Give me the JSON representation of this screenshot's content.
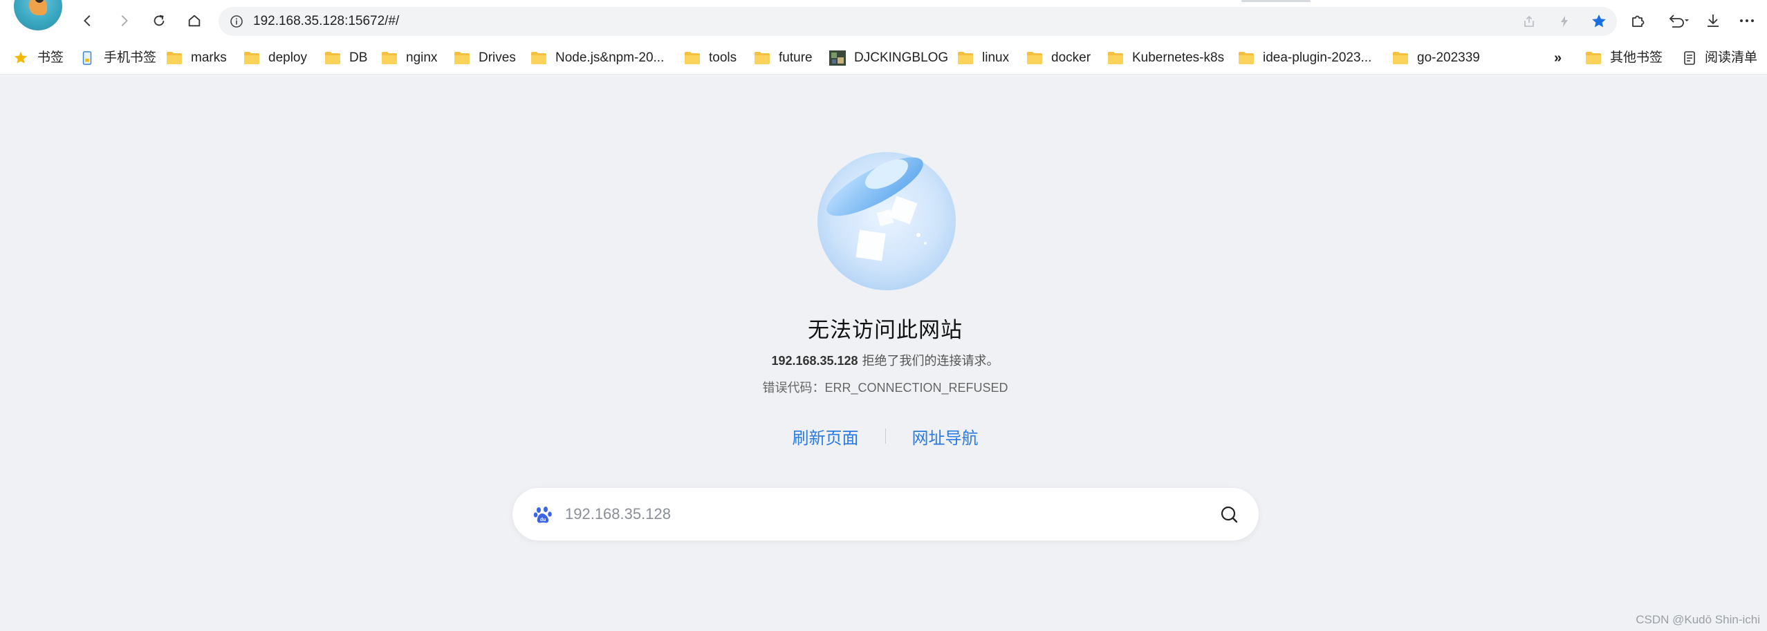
{
  "toolbar": {
    "url": "192.168.35.128:15672/#/",
    "icons": [
      "back-icon",
      "forward-icon",
      "reload-icon",
      "home-icon",
      "info-icon",
      "share-icon",
      "lightning-icon",
      "star-icon",
      "extensions-icon",
      "undo-icon",
      "download-icon",
      "more-icon"
    ],
    "star_color": "#1a6fe0"
  },
  "bookmarks": {
    "items": [
      {
        "label": "书签",
        "icon": "star-icon"
      },
      {
        "label": "手机书签",
        "icon": "phone-icon"
      },
      {
        "label": "marks",
        "icon": "folder-icon"
      },
      {
        "label": "deploy",
        "icon": "folder-icon"
      },
      {
        "label": "DB",
        "icon": "folder-icon"
      },
      {
        "label": "nginx",
        "icon": "folder-icon"
      },
      {
        "label": "Drives",
        "icon": "folder-icon"
      },
      {
        "label": "Node.js&npm-20...",
        "icon": "folder-icon"
      },
      {
        "label": "tools",
        "icon": "folder-icon"
      },
      {
        "label": "future",
        "icon": "folder-icon"
      },
      {
        "label": "DJCKINGBLOG",
        "icon": "favicon-image"
      },
      {
        "label": "linux",
        "icon": "folder-icon"
      },
      {
        "label": "docker",
        "icon": "folder-icon"
      },
      {
        "label": "Kubernetes-k8s",
        "icon": "folder-icon"
      },
      {
        "label": "idea-plugin-2023...",
        "icon": "folder-icon"
      },
      {
        "label": "go-202339",
        "icon": "folder-icon"
      }
    ],
    "overflow": "»",
    "other": "其他书签",
    "reading_list": "阅读清单",
    "folder_color": "#f5c040"
  },
  "error": {
    "title": "无法访问此网站",
    "host": "192.168.35.128",
    "message": "拒绝了我们的连接请求。",
    "code_line": "错误代码：ERR_CONNECTION_REFUSED",
    "refresh": "刷新页面",
    "navigate": "网址导航",
    "link_color": "#2a7ae2"
  },
  "search": {
    "placeholder": "192.168.35.128"
  },
  "watermark": "CSDN @Kudō Shin-ichi"
}
